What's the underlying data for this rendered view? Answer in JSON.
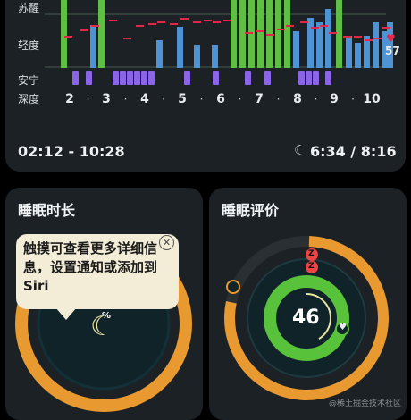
{
  "top_card": {
    "y_labels": [
      "苏醒",
      "轻度",
      "安宁",
      "深度"
    ],
    "x_labels": [
      "2",
      "3",
      "4",
      "5",
      "6",
      "7",
      "8",
      "9",
      "10"
    ],
    "time_range": "02:12 - 10:28",
    "sleep_ratio": "6:34 / 8:16",
    "heart_rate": "57",
    "icons": {
      "moon": "moon-icon",
      "heart": "heart-icon"
    }
  },
  "duration_card": {
    "title": "睡眠时长",
    "tooltip": "触摸可查看更多详细信息，设置通知或添加到 Siri",
    "percent_symbol": "%",
    "close_icon": "close-icon"
  },
  "score_card": {
    "title": "睡眠评价",
    "score": "46",
    "z_badges": [
      "Z",
      "Z"
    ]
  },
  "watermark": "@稀土掘金技术社区",
  "colors": {
    "awake": "#5fbe44",
    "light": "#4e94d4",
    "deep": "#8a66e6",
    "heart": "#e2284a",
    "orange": "#e8992f",
    "green": "#58c23a"
  }
}
